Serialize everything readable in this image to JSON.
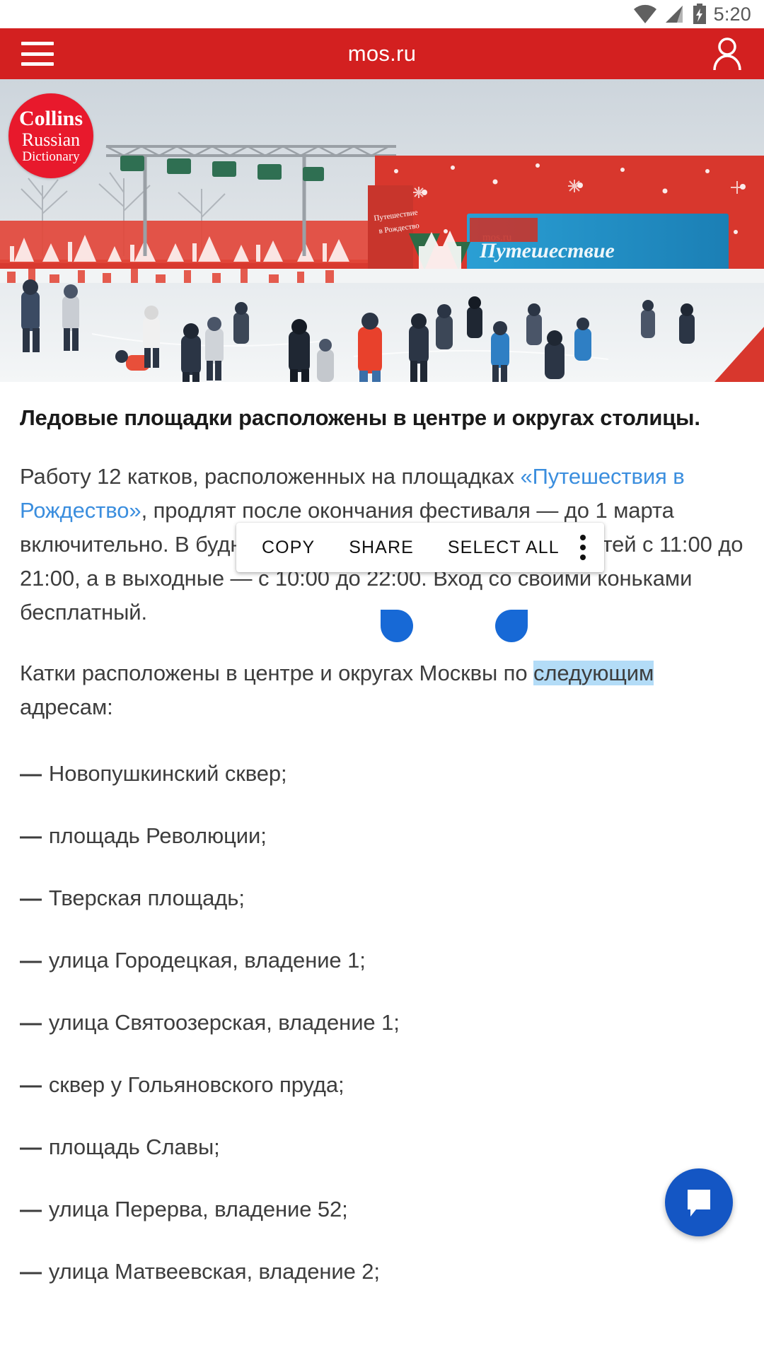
{
  "statusbar": {
    "time": "5:20",
    "icons": [
      "wifi-icon",
      "cellular-signal-icon",
      "battery-charging-icon"
    ]
  },
  "appbar": {
    "title": "mos.ru",
    "menu_icon": "hamburger-menu-icon",
    "account_icon": "account-person-icon",
    "background_color": "#d32020"
  },
  "hero": {
    "badge": {
      "line1": "Collins",
      "line2": "Russian",
      "line3": "Dictionary",
      "color": "#e8192c"
    },
    "alt": "ice-rink-photo"
  },
  "article": {
    "lead": "Ледовые площадки расположены в центре и округах столицы.",
    "paragraph1": {
      "before_link": "Работу 12 катков, расположенных на площадках ",
      "link": "«Путешествия в Рождество»",
      "link_color": "#3b8ede",
      "after_link": ", продлят после окончания фестиваля — до 1 марта включительно. В будние дни ледовые площадки ждут гостей с 11:00 до 21:00, а в выходные — с 10:00 до 22:00. Вход со своими коньками бесплатный."
    },
    "paragraph2": {
      "before_selection": "Катки расположены в центре и округах Москвы по ",
      "selection": "следующим",
      "after_selection": " адресам:",
      "selection_color": "#b3dcf7"
    },
    "list": [
      "Новопушкинский сквер;",
      "площадь Революции;",
      "Тверская площадь;",
      "улица Городецкая, владение 1;",
      "улица Святоозерская, владение 1;",
      "сквер у Гольяновского пруда;",
      "площадь Славы;",
      "улица Перерва, владение 52;",
      "улица Матвеевская, владение 2;"
    ],
    "dash": "—"
  },
  "context_menu": {
    "copy": "COPY",
    "share": "SHARE",
    "select_all": "SELECT ALL",
    "overflow_icon": "more-vertical-icon"
  },
  "selection_handles": {
    "left": "selection-handle-left",
    "right": "selection-handle-right",
    "color": "#1769d6"
  },
  "fab": {
    "icon": "chat-bubble-icon",
    "color": "#1456c4"
  }
}
